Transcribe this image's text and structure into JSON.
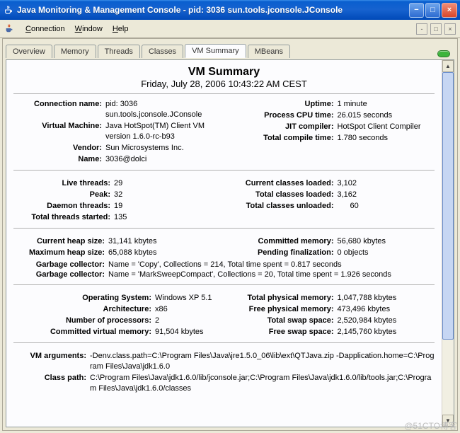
{
  "window": {
    "title": "Java Monitoring & Management Console - pid: 3036 sun.tools.jconsole.JConsole"
  },
  "menu": {
    "connection": "Connection",
    "window_m": "Window",
    "help": "Help"
  },
  "tabs": [
    "Overview",
    "Memory",
    "Threads",
    "Classes",
    "VM Summary",
    "MBeans"
  ],
  "active_tab": "VM Summary",
  "summary_header": {
    "title": "VM Summary",
    "timestamp": "Friday, July 28, 2006 10:43:22 AM CEST"
  },
  "connection": {
    "connection_name_label": "Connection name:",
    "connection_name": "pid: 3036 sun.tools.jconsole.JConsole",
    "virtual_machine_label": "Virtual Machine:",
    "virtual_machine": "Java HotSpot(TM) Client VM version 1.6.0-rc-b93",
    "vendor_label": "Vendor:",
    "vendor": "Sun Microsystems Inc.",
    "name_label": "Name:",
    "name": "3036@dolci",
    "uptime_label": "Uptime:",
    "uptime": "1 minute",
    "cpu_label": "Process CPU time:",
    "cpu": "26.015 seconds",
    "jit_label": "JIT compiler:",
    "jit": "HotSpot Client Compiler",
    "compile_label": "Total compile time:",
    "compile": "1.780 seconds"
  },
  "threads": {
    "live_label": "Live threads:",
    "live": "29",
    "peak_label": "Peak:",
    "peak": "32",
    "daemon_label": "Daemon threads:",
    "daemon": "19",
    "started_label": "Total threads started:",
    "started": "135",
    "cls_loaded_label": "Current classes loaded:",
    "cls_loaded": "3,102",
    "cls_total_label": "Total classes loaded:",
    "cls_total": "3,162",
    "cls_unloaded_label": "Total classes unloaded:",
    "cls_unloaded": "60"
  },
  "heap": {
    "current_label": "Current heap size:",
    "current": "31,141 kbytes",
    "max_label": "Maximum heap size:",
    "max": "65,088 kbytes",
    "committed_label": "Committed memory:",
    "committed": "56,680 kbytes",
    "pending_label": "Pending finalization:",
    "pending": "0 objects",
    "gc_label": "Garbage collector:",
    "gc1": "Name = 'Copy', Collections = 214, Total time spent = 0.817 seconds",
    "gc2": "Name = 'MarkSweepCompact', Collections = 20, Total time spent = 1.926 seconds"
  },
  "os": {
    "os_label": "Operating System:",
    "os": "Windows XP 5.1",
    "arch_label": "Architecture:",
    "arch": "x86",
    "nproc_label": "Number of processors:",
    "nproc": "2",
    "cvm_label": "Committed virtual memory:",
    "cvm": "91,504 kbytes",
    "tphys_label": "Total physical memory:",
    "tphys": "1,047,788 kbytes",
    "fphys_label": "Free physical memory:",
    "fphys": "473,496 kbytes",
    "tswap_label": "Total swap space:",
    "tswap": "2,520,984 kbytes",
    "fswap_label": "Free swap space:",
    "fswap": "2,145,760 kbytes"
  },
  "vm": {
    "args_label": "VM arguments:",
    "args": "-Denv.class.path=C:\\Program Files\\Java\\jre1.5.0_06\\lib\\ext\\QTJava.zip -Dapplication.home=C:\\Program Files\\Java\\jdk1.6.0",
    "cp_label": "Class path:",
    "cp": "C:\\Program Files\\Java\\jdk1.6.0/lib/jconsole.jar;C:\\Program Files\\Java\\jdk1.6.0/lib/tools.jar;C:\\Program Files\\Java\\jdk1.6.0/classes"
  },
  "watermark": "@51CTO博客"
}
